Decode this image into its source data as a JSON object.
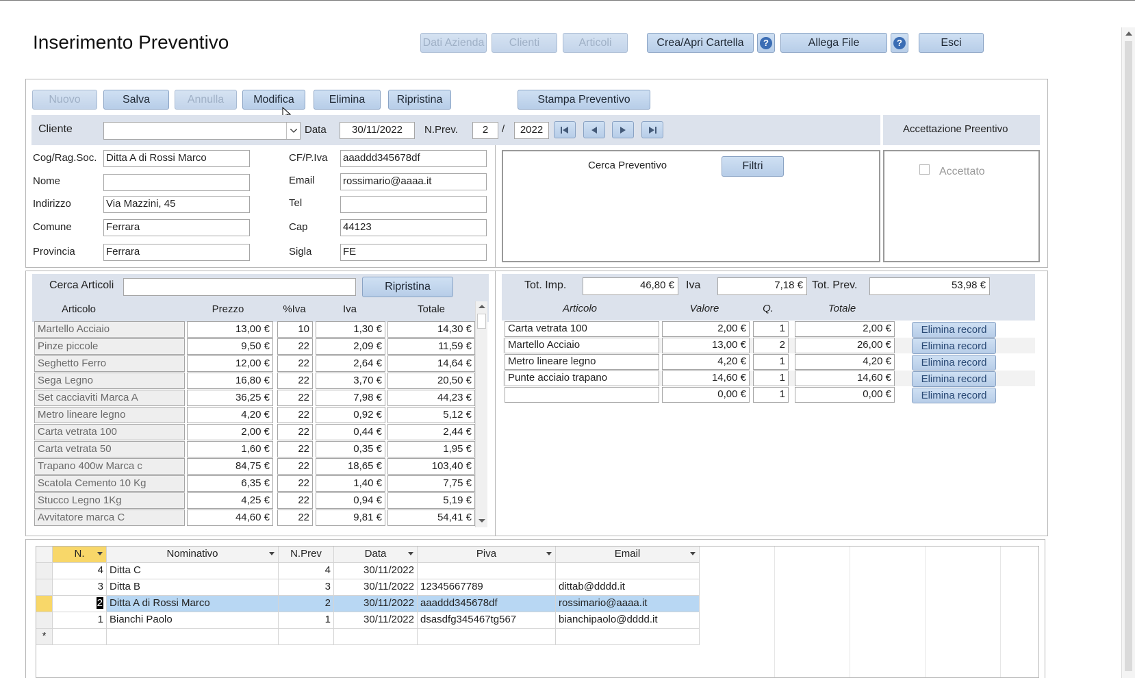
{
  "header": {
    "title": "Inserimento Preventivo",
    "buttons": {
      "dati_azienda": "Dati Azienda",
      "clienti": "Clienti",
      "articoli": "Articoli",
      "crea_apri_cartella": "Crea/Apri Cartella",
      "allega_file": "Allega File",
      "esci": "Esci",
      "help": "?"
    }
  },
  "toolbar": {
    "nuovo": "Nuovo",
    "salva": "Salva",
    "annulla": "Annulla",
    "modifica": "Modifica",
    "elimina": "Elimina",
    "ripristina": "Ripristina",
    "stampa": "Stampa Preventivo"
  },
  "customer": {
    "cliente_label": "Cliente",
    "cliente_value": "",
    "data_label": "Data",
    "data_value": "30/11/2022",
    "nprev_label": "N.Prev.",
    "nprev_value": "2",
    "slash": "/",
    "year_value": "2022",
    "fields": {
      "cog_label": "Cog/Rag.Soc.",
      "cog_value": "Ditta A di Rossi Marco",
      "nome_label": "Nome",
      "nome_value": "",
      "indirizzo_label": "Indirizzo",
      "indirizzo_value": "Via Mazzini, 45",
      "comune_label": "Comune",
      "comune_value": "Ferrara",
      "provincia_label": "Provincia",
      "provincia_value": "Ferrara",
      "cf_label": "CF/P.Iva",
      "cf_value": "aaaddd345678df",
      "email_label": "Email",
      "email_value": "rossimario@aaaa.it",
      "tel_label": "Tel",
      "tel_value": "",
      "cap_label": "Cap",
      "cap_value": "44123",
      "sigla_label": "Sigla",
      "sigla_value": "FE"
    }
  },
  "search": {
    "cerca_preventivo": "Cerca Preventivo",
    "filtri": "Filtri"
  },
  "accept": {
    "title": "Accettazione Preentivo",
    "checkbox_label": "Accettato",
    "checked": false
  },
  "articles": {
    "search_label": "Cerca Articoli",
    "search_value": "",
    "reset_label": "Ripristina",
    "headers": [
      "Articolo",
      "Prezzo",
      "%Iva",
      "Iva",
      "Totale"
    ],
    "rows": [
      [
        "Martello Acciaio",
        "13,00 €",
        "10",
        "1,30 €",
        "14,30 €"
      ],
      [
        "Pinze piccole",
        "9,50 €",
        "22",
        "2,09 €",
        "11,59 €"
      ],
      [
        "Seghetto Ferro",
        "12,00 €",
        "22",
        "2,64 €",
        "14,64 €"
      ],
      [
        "Sega Legno",
        "16,80 €",
        "22",
        "3,70 €",
        "20,50 €"
      ],
      [
        "Set cacciaviti Marca A",
        "36,25 €",
        "22",
        "7,98 €",
        "44,23 €"
      ],
      [
        "Metro lineare legno",
        "4,20 €",
        "22",
        "0,92 €",
        "5,12 €"
      ],
      [
        "Carta vetrata 100",
        "2,00 €",
        "22",
        "0,44 €",
        "2,44 €"
      ],
      [
        "Carta vetrata 50",
        "1,60 €",
        "22",
        "0,35 €",
        "1,95 €"
      ],
      [
        "Trapano 400w Marca c",
        "84,75 €",
        "22",
        "18,65 €",
        "103,40 €"
      ],
      [
        "Scatola Cemento 10 Kg",
        "6,35 €",
        "22",
        "1,40 €",
        "7,75 €"
      ],
      [
        "Stucco Legno 1Kg",
        "4,25 €",
        "22",
        "0,94 €",
        "5,19 €"
      ],
      [
        "Avvitatore marca C",
        "44,60 €",
        "22",
        "9,81 €",
        "54,41 €"
      ]
    ]
  },
  "totals": {
    "imp_label": "Tot. Imp.",
    "imp_value": "46,80 €",
    "iva_label": "Iva",
    "iva_value": "7,18 €",
    "prev_label": "Tot. Prev.",
    "prev_value": "53,98 €"
  },
  "lines": {
    "headers": [
      "Articolo",
      "Valore",
      "Q.",
      "Totale"
    ],
    "delete_label": "Elimina record",
    "rows": [
      [
        "Carta vetrata 100",
        "2,00 €",
        "1",
        "2,00 €"
      ],
      [
        "Martello Acciaio",
        "13,00 €",
        "2",
        "26,00 €"
      ],
      [
        "Metro lineare legno",
        "4,20 €",
        "1",
        "4,20 €"
      ],
      [
        "Punte acciaio trapano",
        "14,60 €",
        "1",
        "14,60 €"
      ],
      [
        "",
        "0,00 €",
        "1",
        "0,00 €"
      ]
    ]
  },
  "datasheet": {
    "headers": [
      "N.",
      "Nominativo",
      "N.Prev",
      "Data",
      "Piva",
      "Email"
    ],
    "rows": [
      [
        "4",
        "Ditta C",
        "4",
        "30/11/2022",
        "",
        ""
      ],
      [
        "3",
        "Ditta B",
        "3",
        "30/11/2022",
        "12345667789",
        "dittab@dddd.it"
      ],
      [
        "2",
        "Ditta A di Rossi Marco",
        "2",
        "30/11/2022",
        "aaaddd345678df",
        "rossimario@aaaa.it"
      ],
      [
        "1",
        "Bianchi Paolo",
        "1",
        "30/11/2022",
        "dsasdfg345467tg567",
        "bianchipaolo@dddd.it"
      ]
    ],
    "selected_index": 2,
    "new_row_marker": "*"
  }
}
